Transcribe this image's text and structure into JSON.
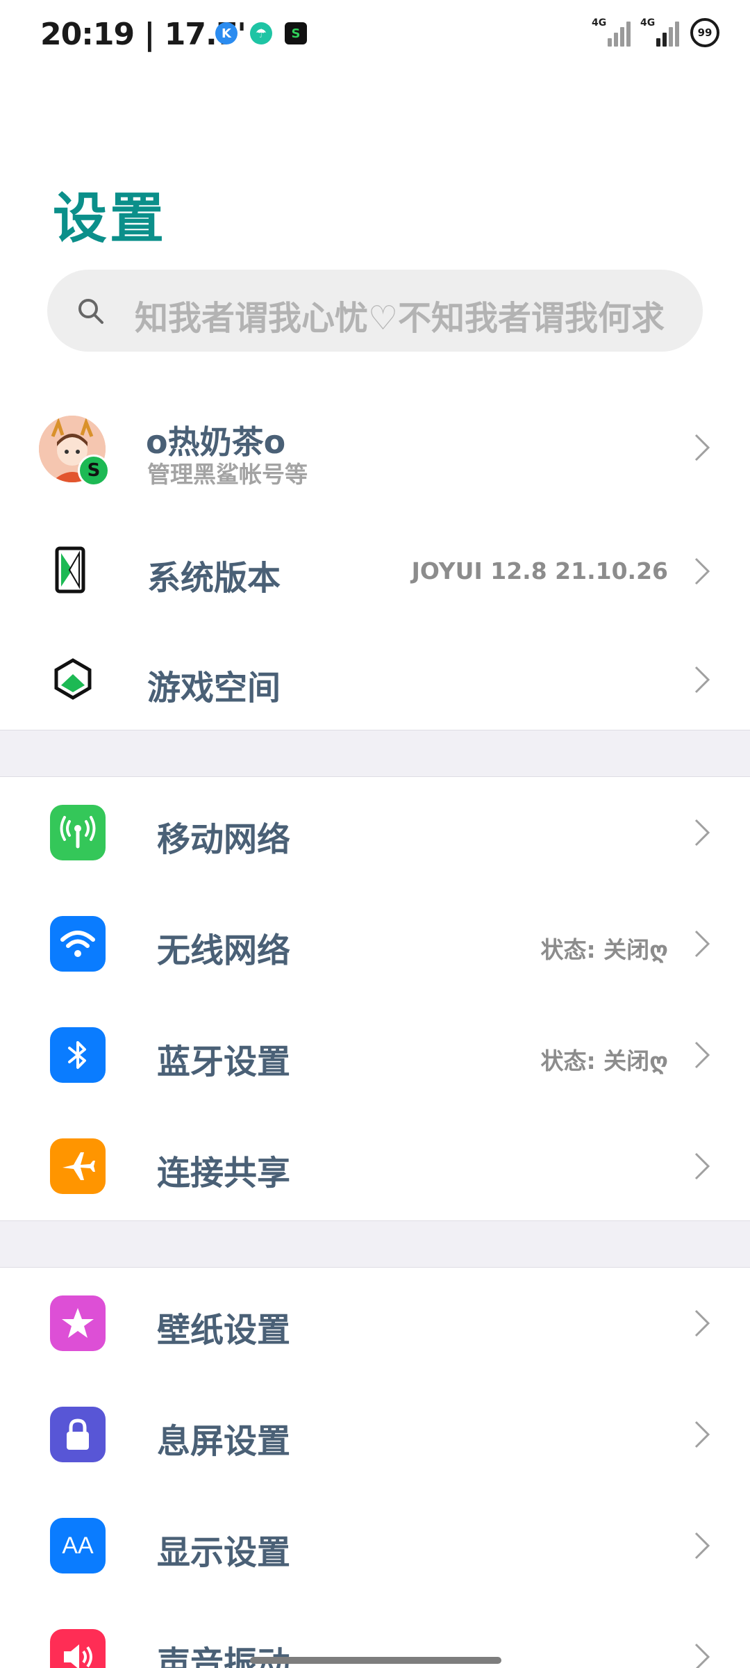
{
  "status_bar": {
    "time": "20:19 | 17.7'",
    "network_1": "4G",
    "network_2": "4G",
    "battery": "99"
  },
  "title": "设置",
  "search": {
    "placeholder": "知我者谓我心忧♡不知我者谓我何求"
  },
  "account": {
    "name": "o热奶茶o",
    "subtitle": "管理黑鲨帐号等"
  },
  "rows": {
    "system_version": {
      "label": "系统版本",
      "value": "JOYUI 12.8 21.10.26"
    },
    "game_space": {
      "label": "游戏空间"
    },
    "mobile_network": {
      "label": "移动网络"
    },
    "wifi": {
      "label": "无线网络",
      "value": "状态: 关闭ღ"
    },
    "bluetooth": {
      "label": "蓝牙设置",
      "value": "状态: 关闭ღ"
    },
    "connect_share": {
      "label": "连接共享"
    },
    "wallpaper": {
      "label": "壁纸设置"
    },
    "lock_screen": {
      "label": "息屏设置"
    },
    "display": {
      "label": "显示设置"
    },
    "sound": {
      "label": "声音振动"
    }
  },
  "icon_colors": {
    "mobile_network": "#34c759",
    "wifi": "#0a7cff",
    "bluetooth": "#0a7cff",
    "connect_share": "#ff9500",
    "wallpaper": "#dd4fd6",
    "lock_screen": "#5856d6",
    "display": "#0a7cff",
    "sound": "#ff2d55",
    "title": "#0b8f8a"
  },
  "icons": {
    "display_icon_text": "AA"
  }
}
